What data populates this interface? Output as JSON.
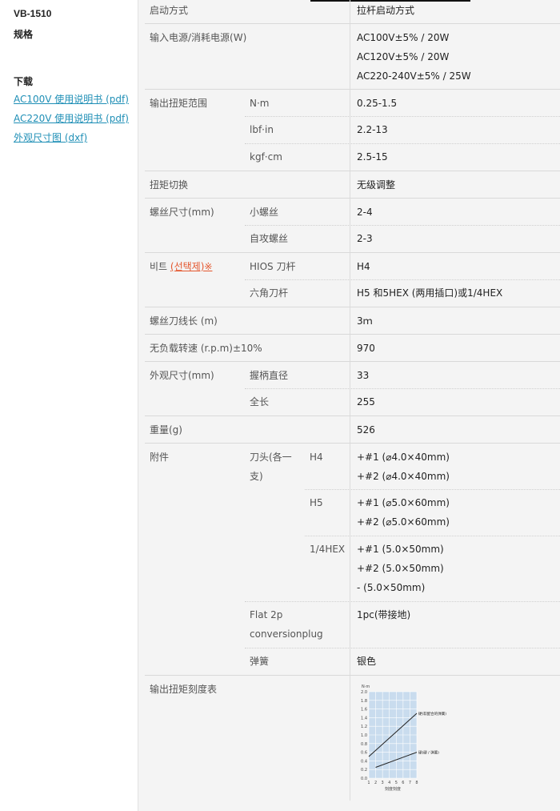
{
  "sidebar": {
    "model": "VB-1510",
    "spec": "规格",
    "download": "下载",
    "links": [
      "AC100V 使用说明书 (pdf)",
      "AC220V 使用说明书 (pdf)",
      "外观尺寸图 (dxf)"
    ]
  },
  "rows": {
    "start": {
      "label": "启动方式",
      "value": "拉杆启动方式"
    },
    "power": {
      "label": "输入电源/消耗电源(W)",
      "values": [
        "AC100V±5% / 20W",
        "AC120V±5% / 20W",
        "AC220-240V±5% / 25W"
      ]
    },
    "torque": {
      "label": "输出扭矩范围",
      "items": [
        {
          "unit": "N·m",
          "value": "0.25-1.5"
        },
        {
          "unit": "lbf·in",
          "value": "2.2-13"
        },
        {
          "unit": "kgf·cm",
          "value": "2.5-15"
        }
      ]
    },
    "switch": {
      "label": "扭矩切换",
      "value": "无级调整"
    },
    "screw": {
      "label": "螺丝尺寸(mm)",
      "items": [
        {
          "sub": "小螺丝",
          "value": "2-4"
        },
        {
          "sub": "自攻螺丝",
          "value": "2-3"
        }
      ]
    },
    "bit": {
      "label_prefix": "비트 ",
      "label_link": "(선택제)※",
      "items": [
        {
          "sub": "HIOS 刀杆",
          "value": "H4"
        },
        {
          "sub": "六角刀杆",
          "value": "H5 和5HEX (两用插口)或1/4HEX"
        }
      ]
    },
    "cord": {
      "label": "螺丝刀线长 (m)",
      "value": "3ｍ"
    },
    "speed": {
      "label": "无负载转速 (r.p.m)±10%",
      "value": "970"
    },
    "dims": {
      "label": "外观尺寸(mm)",
      "items": [
        {
          "sub": "握柄直径",
          "value": "33"
        },
        {
          "sub": "全长",
          "value": "255"
        }
      ]
    },
    "weight": {
      "label": "重量(g)",
      "value": "526"
    },
    "accessories": {
      "label": "附件",
      "bits_label_1": "刀头(各一",
      "bits_label_2": "支)",
      "groups": [
        {
          "type": "H4",
          "lines": [
            "+#1 (⌀4.0×40mm)",
            "+#2 (⌀4.0×40mm)"
          ]
        },
        {
          "type": "H5",
          "lines": [
            "+#1 (⌀5.0×60mm)",
            "+#2 (⌀5.0×60mm)"
          ]
        },
        {
          "type": "1/4HEX",
          "lines": [
            "+#1 (5.0×50mm)",
            "+#2 (5.0×50mm)",
            "- (5.0×50mm)"
          ]
        }
      ],
      "plug_label_1": "Flat 2p",
      "plug_label_2": "conversionplug",
      "plug_value": "1pc(带接地)",
      "spring_label": "弹簧",
      "spring_value": "银色"
    },
    "chart_row": {
      "label": "输出扭矩刻度表"
    }
  },
  "chart_data": {
    "type": "line",
    "ylabel": "N·m",
    "xlabel": "刻度刻度",
    "x_ticks": [
      1,
      2,
      3,
      4,
      5,
      6,
      7,
      8
    ],
    "y_ticks": [
      "0.0",
      "0.2",
      "0.4",
      "0.6",
      "0.8",
      "1.0",
      "1.2",
      "1.4",
      "1.6",
      "1.8",
      "2.0"
    ],
    "xlim": [
      1,
      8
    ],
    "ylim": [
      0,
      2.0
    ],
    "grid": true,
    "series": [
      {
        "name": "硬(软配合的弹簧)",
        "x": [
          1,
          8
        ],
        "y": [
          0.5,
          1.5
        ]
      },
      {
        "name": "硬(硬 / 弹簧)",
        "x": [
          2,
          8
        ],
        "y": [
          0.25,
          0.6
        ]
      }
    ],
    "colors": {
      "plot_bg": "#c9dcee",
      "line": "#222222"
    }
  }
}
